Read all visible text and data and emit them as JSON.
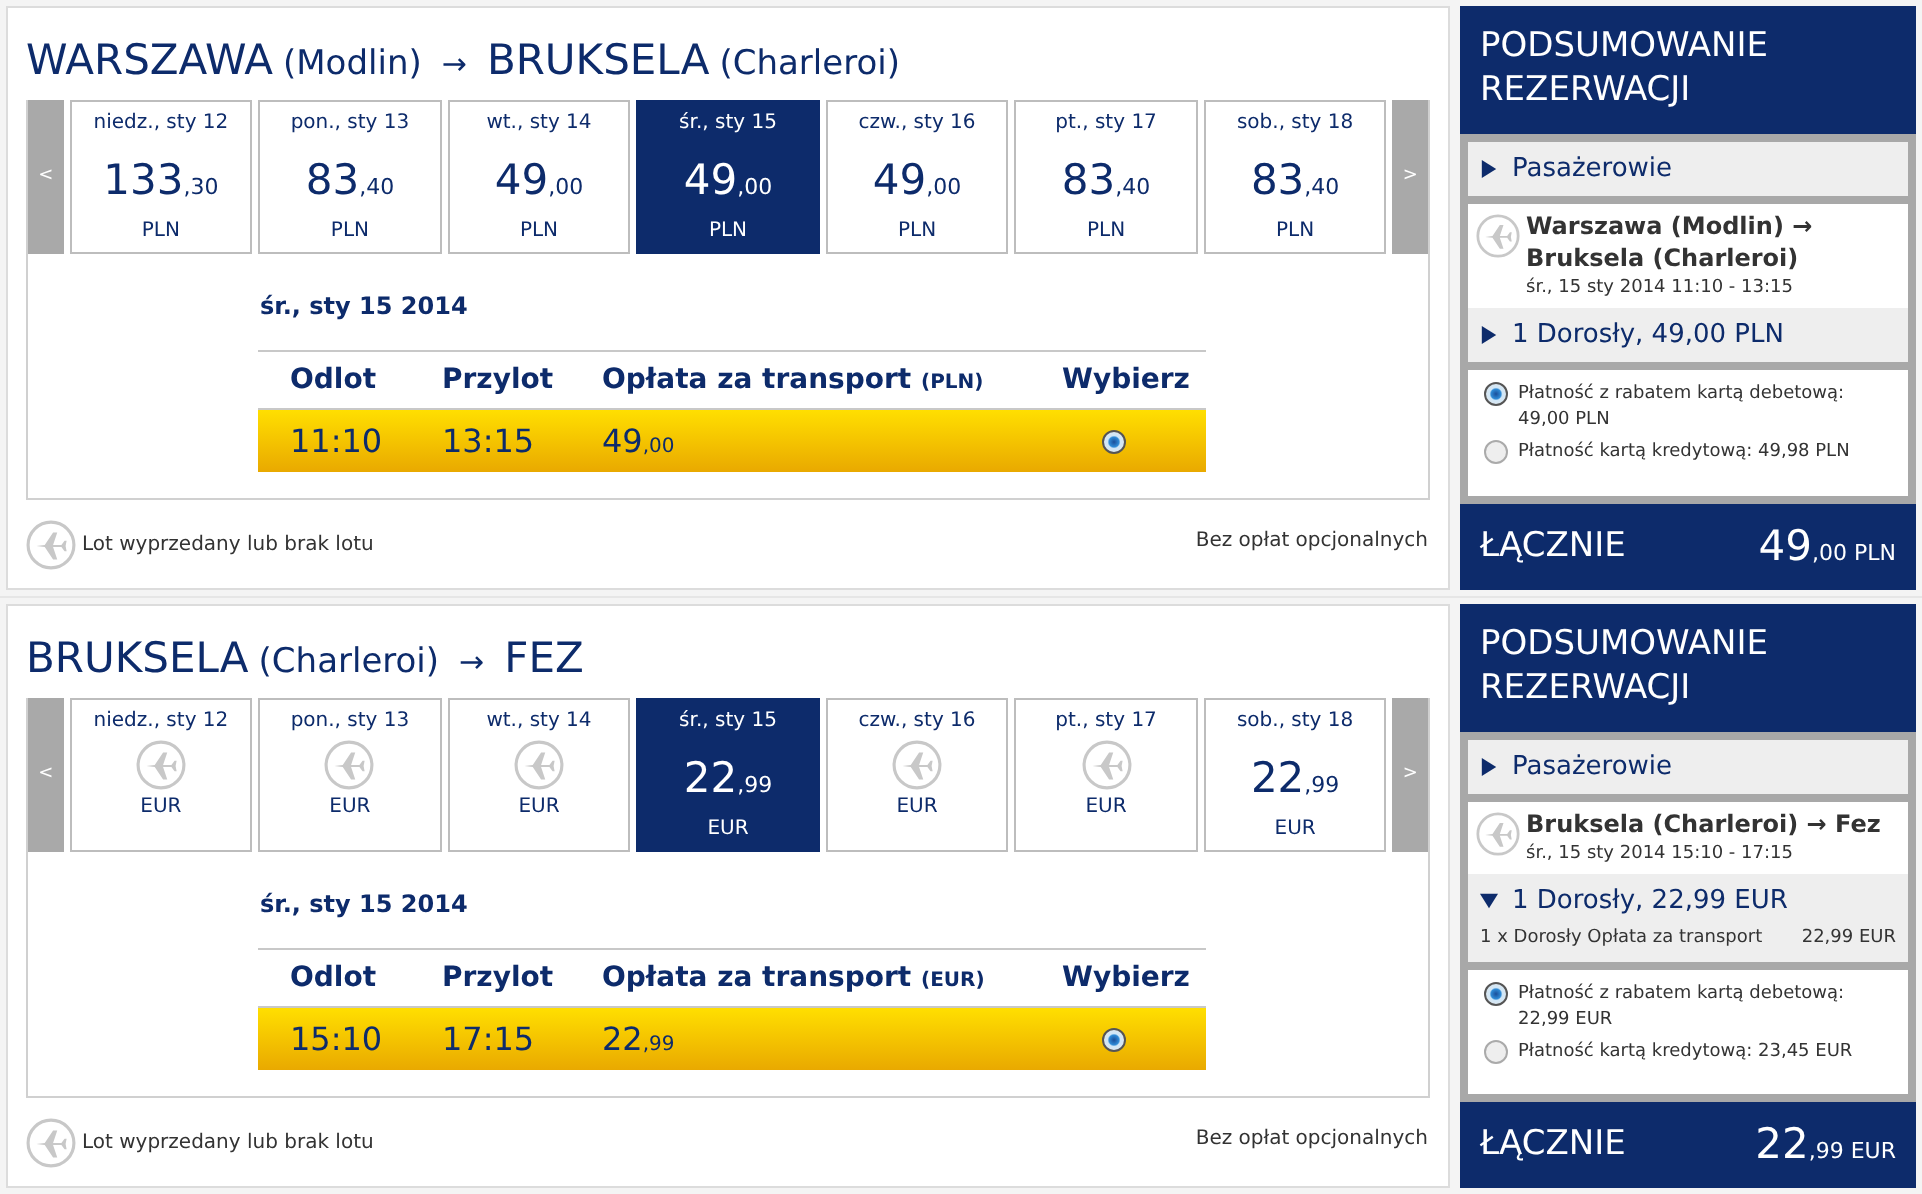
{
  "flights": [
    {
      "title": {
        "origin": "WARSZAWA",
        "origin_airport": "(Modlin)",
        "arrow": "→",
        "destination": "BRUKSELA",
        "destination_airport": "(Charleroi)"
      },
      "prev": "<",
      "next": ">",
      "days": [
        {
          "label": "niedz., sty 12",
          "available": true,
          "price": "133",
          "decimals": ",30",
          "currency": "PLN",
          "selected": false
        },
        {
          "label": "pon., sty 13",
          "available": true,
          "price": "83",
          "decimals": ",40",
          "currency": "PLN",
          "selected": false
        },
        {
          "label": "wt., sty 14",
          "available": true,
          "price": "49",
          "decimals": ",00",
          "currency": "PLN",
          "selected": false
        },
        {
          "label": "śr., sty 15",
          "available": true,
          "price": "49",
          "decimals": ",00",
          "currency": "PLN",
          "selected": true
        },
        {
          "label": "czw., sty 16",
          "available": true,
          "price": "49",
          "decimals": ",00",
          "currency": "PLN",
          "selected": false
        },
        {
          "label": "pt., sty 17",
          "available": true,
          "price": "83",
          "decimals": ",40",
          "currency": "PLN",
          "selected": false
        },
        {
          "label": "sob., sty 18",
          "available": true,
          "price": "83",
          "decimals": ",40",
          "currency": "PLN",
          "selected": false
        }
      ],
      "selected_date": "śr., sty 15 2014",
      "columns": {
        "departure": "Odlot",
        "arrival": "Przylot",
        "fare": "Opłata za transport",
        "fare_currency": "(PLN)",
        "select": "Wybierz"
      },
      "rows": [
        {
          "departure": "11:10",
          "arrival": "13:15",
          "price": "49",
          "decimals": ",00",
          "selected": true
        }
      ],
      "legend": "Lot wyprzedany lub brak lotu",
      "note": "Bez opłat opcjonalnych",
      "summary": {
        "title": "PODSUMOWANIE REZERWACJI",
        "passengers": {
          "label": "Pasażerowie",
          "expanded": false
        },
        "route": "Warszawa (Modlin) → Bruksela (Charleroi)",
        "time": "śr., 15 sty 2014 11:10 - 13:15",
        "fare": {
          "label": "1 Dorosły, 49,00 PLN",
          "expanded": false
        },
        "payments": [
          {
            "label": "Płatność z rabatem kartą debetową: 49,00 PLN",
            "selected": true
          },
          {
            "label": "Płatność kartą kredytową: 49,98 PLN",
            "selected": false
          }
        ],
        "total_label": "ŁĄCZNIE",
        "total": "49",
        "total_decimals": ",00",
        "total_currency": "PLN"
      }
    },
    {
      "title": {
        "origin": "BRUKSELA",
        "origin_airport": "(Charleroi)",
        "arrow": "→",
        "destination": "FEZ"
      },
      "prev": "<",
      "next": ">",
      "days": [
        {
          "label": "niedz., sty 12",
          "available": false,
          "currency": "EUR",
          "selected": false
        },
        {
          "label": "pon., sty 13",
          "available": false,
          "currency": "EUR",
          "selected": false
        },
        {
          "label": "wt., sty 14",
          "available": false,
          "currency": "EUR",
          "selected": false
        },
        {
          "label": "śr., sty 15",
          "available": true,
          "price": "22",
          "decimals": ",99",
          "currency": "EUR",
          "selected": true
        },
        {
          "label": "czw., sty 16",
          "available": false,
          "currency": "EUR",
          "selected": false
        },
        {
          "label": "pt., sty 17",
          "available": false,
          "currency": "EUR",
          "selected": false
        },
        {
          "label": "sob., sty 18",
          "available": true,
          "price": "22",
          "decimals": ",99",
          "currency": "EUR",
          "selected": false
        }
      ],
      "selected_date": "śr., sty 15 2014",
      "columns": {
        "departure": "Odlot",
        "arrival": "Przylot",
        "fare": "Opłata za transport",
        "fare_currency": "(EUR)",
        "select": "Wybierz"
      },
      "rows": [
        {
          "departure": "15:10",
          "arrival": "17:15",
          "price": "22",
          "decimals": ",99",
          "selected": true
        }
      ],
      "legend": "Lot wyprzedany lub brak lotu",
      "note": "Bez opłat opcjonalnych",
      "summary": {
        "title": "PODSUMOWANIE REZERWACJI",
        "passengers": {
          "label": "Pasażerowie",
          "expanded": false
        },
        "route": "Bruksela (Charleroi) → Fez",
        "time": "śr., 15 sty 2014 15:10 - 17:15",
        "fare": {
          "label": "1 Dorosły, 22,99 EUR",
          "expanded": true,
          "details": [
            {
              "text": "1 x Dorosły Opłata za transport",
              "amount": "22,99 EUR"
            }
          ]
        },
        "payments": [
          {
            "label": "Płatność z rabatem kartą debetową: 22,99 EUR",
            "selected": true
          },
          {
            "label": "Płatność kartą kredytową: 23,45 EUR",
            "selected": false
          }
        ],
        "total_label": "ŁĄCZNIE",
        "total": "22",
        "total_decimals": ",99",
        "total_currency": "EUR"
      }
    }
  ]
}
